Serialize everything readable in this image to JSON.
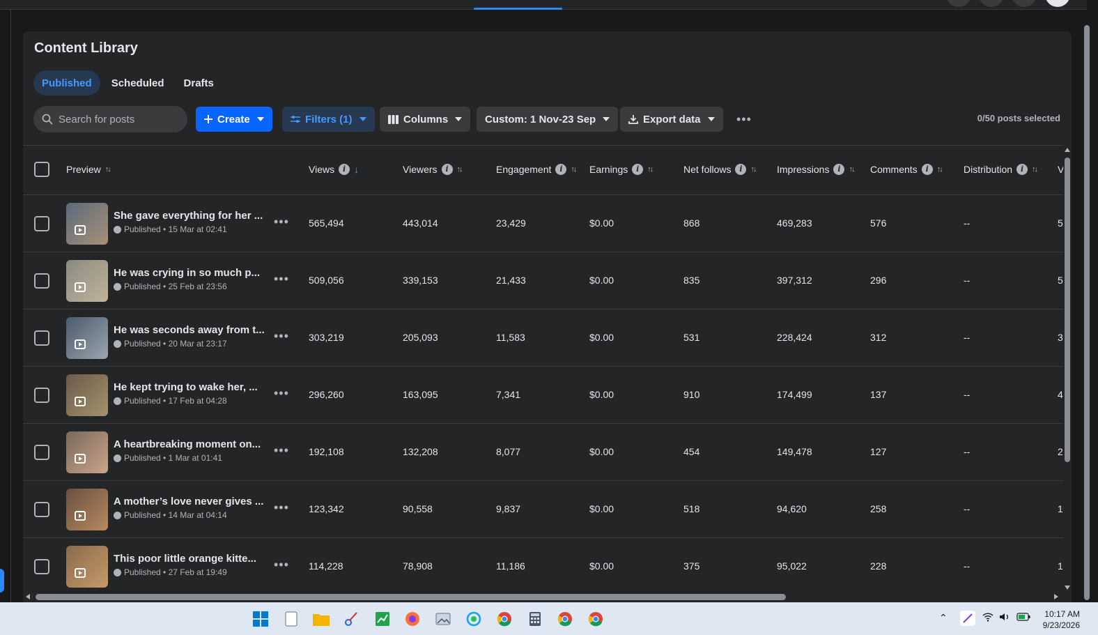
{
  "page": {
    "title": "Content Library",
    "tabs": [
      "Published",
      "Scheduled",
      "Drafts"
    ]
  },
  "toolbar": {
    "search_placeholder": "Search for posts",
    "create_label": "Create",
    "filters_label": "Filters (1)",
    "columns_label": "Columns",
    "date_range_label": "Custom: 1 Nov-23 Sep",
    "export_label": "Export data",
    "selected_count": "0/50 posts selected"
  },
  "table": {
    "headers": [
      "Preview",
      "Views",
      "Viewers",
      "Engagement",
      "Earnings",
      "Net follows",
      "Impressions",
      "Comments",
      "Distribution",
      "V"
    ],
    "rows": [
      {
        "title": "She gave everything for her ...",
        "status": "Published • 15 Mar at 02:41",
        "views": "565,494",
        "viewers": "443,014",
        "engagement": "23,429",
        "earnings": "$0.00",
        "net_follows": "868",
        "impressions": "469,283",
        "comments": "576",
        "distribution": "--",
        "extra": "5"
      },
      {
        "title": "He was crying in so much p...",
        "status": "Published • 25 Feb at 23:56",
        "views": "509,056",
        "viewers": "339,153",
        "engagement": "21,433",
        "earnings": "$0.00",
        "net_follows": "835",
        "impressions": "397,312",
        "comments": "296",
        "distribution": "--",
        "extra": "5"
      },
      {
        "title": "He was seconds away from t...",
        "status": "Published • 20 Mar at 23:17",
        "views": "303,219",
        "viewers": "205,093",
        "engagement": "11,583",
        "earnings": "$0.00",
        "net_follows": "531",
        "impressions": "228,424",
        "comments": "312",
        "distribution": "--",
        "extra": "3"
      },
      {
        "title": "He kept trying to wake her, ...",
        "status": "Published • 17 Feb at 04:28",
        "views": "296,260",
        "viewers": "163,095",
        "engagement": "7,341",
        "earnings": "$0.00",
        "net_follows": "910",
        "impressions": "174,499",
        "comments": "137",
        "distribution": "--",
        "extra": "4"
      },
      {
        "title": "A heartbreaking moment on...",
        "status": "Published • 1 Mar at 01:41",
        "views": "192,108",
        "viewers": "132,208",
        "engagement": "8,077",
        "earnings": "$0.00",
        "net_follows": "454",
        "impressions": "149,478",
        "comments": "127",
        "distribution": "--",
        "extra": "2"
      },
      {
        "title": "A mother’s love never gives ...",
        "status": "Published • 14 Mar at 04:14",
        "views": "123,342",
        "viewers": "90,558",
        "engagement": "9,837",
        "earnings": "$0.00",
        "net_follows": "518",
        "impressions": "94,620",
        "comments": "258",
        "distribution": "--",
        "extra": "1"
      },
      {
        "title": "This poor little orange kitte...",
        "status": "Published • 27 Feb at 19:49",
        "views": "114,228",
        "viewers": "78,908",
        "engagement": "11,186",
        "earnings": "$0.00",
        "net_follows": "375",
        "impressions": "95,022",
        "comments": "228",
        "distribution": "--",
        "extra": "1"
      }
    ]
  },
  "taskbar": {
    "time": "10:17 AM",
    "date": "9/23/2026"
  },
  "colors": {
    "accent": "#0866ff",
    "accent_soft": "#263951",
    "accent_text": "#4599ff",
    "panel": "#242526",
    "background": "#18191a"
  }
}
